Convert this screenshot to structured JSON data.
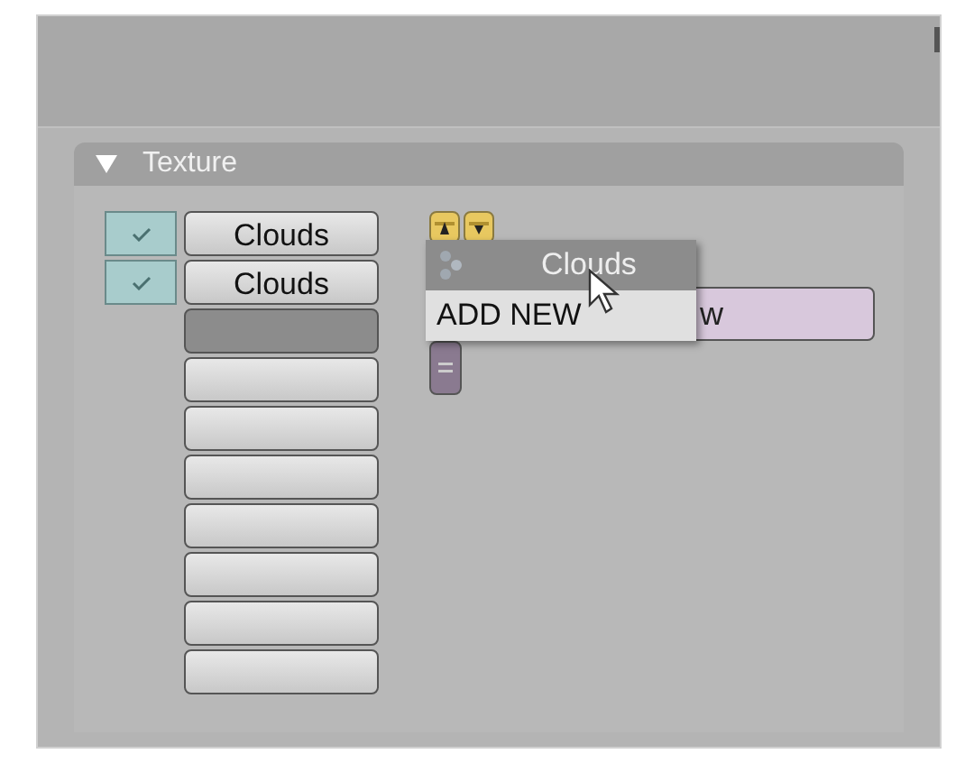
{
  "panel": {
    "title": "Texture",
    "expanded": true
  },
  "slots": [
    {
      "kind": "filled",
      "name": "Clouds",
      "checked": true,
      "selected": false
    },
    {
      "kind": "filled",
      "name": "Clouds",
      "checked": true,
      "selected": false
    },
    {
      "kind": "empty",
      "selected": true
    },
    {
      "kind": "empty",
      "selected": false
    },
    {
      "kind": "empty",
      "selected": false
    },
    {
      "kind": "empty",
      "selected": false
    },
    {
      "kind": "empty",
      "selected": false
    },
    {
      "kind": "empty",
      "selected": false
    },
    {
      "kind": "empty",
      "selected": false
    },
    {
      "kind": "empty",
      "selected": false
    }
  ],
  "texture_field": {
    "value": "w"
  },
  "menu": [
    {
      "kind": "texture",
      "label": "Clouds",
      "selected": true
    },
    {
      "kind": "action",
      "label": "ADD NEW",
      "selected": false
    }
  ]
}
